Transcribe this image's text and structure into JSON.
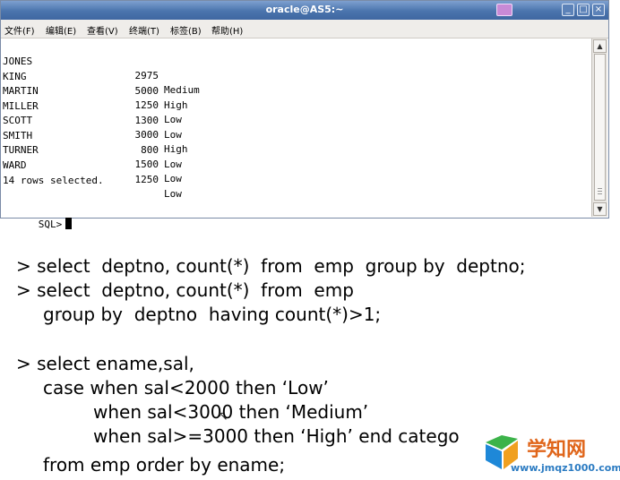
{
  "window": {
    "title": "oracle@AS5:~",
    "menu": [
      "文件(F)",
      "编辑(E)",
      "查看(V)",
      "终端(T)",
      "标签(B)",
      "帮助(H)"
    ]
  },
  "terminal": {
    "rows": [
      {
        "name": "JONES",
        "sal": "2975",
        "cat": "Medium"
      },
      {
        "name": "KING",
        "sal": "5000",
        "cat": "High"
      },
      {
        "name": "MARTIN",
        "sal": "1250",
        "cat": "Low"
      },
      {
        "name": "MILLER",
        "sal": "1300",
        "cat": "Low"
      },
      {
        "name": "SCOTT",
        "sal": "3000",
        "cat": "High"
      },
      {
        "name": "SMITH",
        "sal": "800",
        "cat": "Low"
      },
      {
        "name": "TURNER",
        "sal": "1500",
        "cat": "Low"
      },
      {
        "name": "WARD",
        "sal": "1250",
        "cat": "Low"
      }
    ],
    "summary": "14 rows selected.",
    "prompt": "SQL>"
  },
  "slide": {
    "lines": [
      "> select  deptno, count(*)  from  emp  group by  deptno;",
      "> select  deptno, count(*)  from  emp",
      "group by  deptno  having count(*)>1;",
      "> select ename,sal,",
      "case when sal<2000 then ‘Low’",
      "when sal<3000 then ‘Medium’",
      "when sal>=3000 then ‘High’ end catego",
      "from emp order by ename;"
    ]
  },
  "watermark": {
    "brand": "学知网",
    "url": "www.jmqz1000.com"
  }
}
